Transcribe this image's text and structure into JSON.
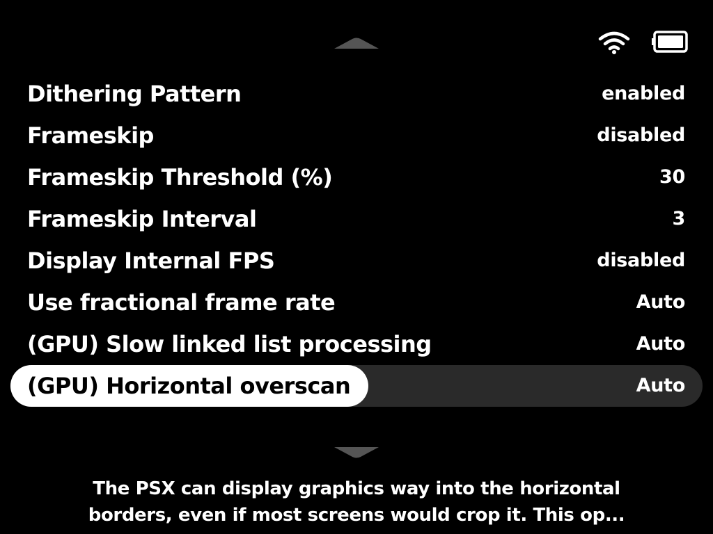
{
  "theme": {
    "background": "#000000",
    "text": "#ffffff",
    "selected_pill": "#ffffff",
    "selected_track": "#2a2a2a",
    "indicator": "#555555"
  },
  "status_bar": {
    "wifi_icon": "wifi-icon",
    "battery_icon": "battery-icon"
  },
  "menu": {
    "items": [
      {
        "label": "Dithering Pattern",
        "value": "enabled"
      },
      {
        "label": "Frameskip",
        "value": "disabled"
      },
      {
        "label": "Frameskip Threshold (%)",
        "value": "30"
      },
      {
        "label": "Frameskip Interval",
        "value": "3"
      },
      {
        "label": "Display Internal FPS",
        "value": "disabled"
      },
      {
        "label": "Use fractional frame rate",
        "value": "Auto"
      },
      {
        "label": "(GPU) Slow linked list processing",
        "value": "Auto"
      },
      {
        "label": "(GPU) Horizontal overscan",
        "value": "Auto",
        "selected": true
      }
    ]
  },
  "description": {
    "line1": "The PSX can display graphics way into the horizontal",
    "line2": "borders, even if most screens would crop it. This op..."
  }
}
